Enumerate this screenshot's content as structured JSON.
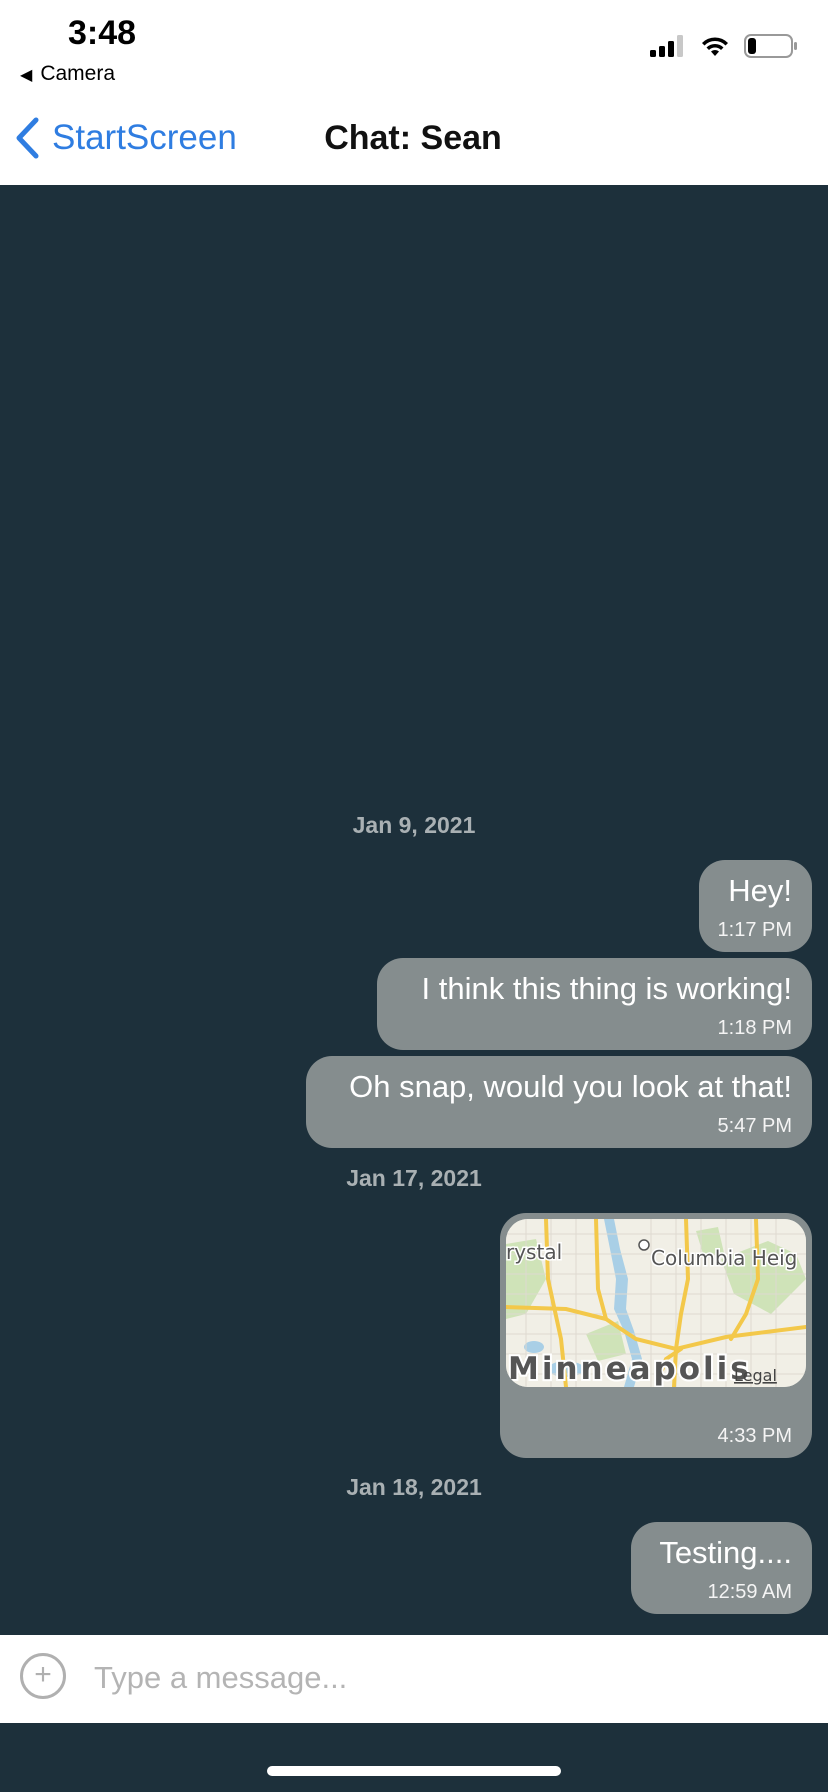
{
  "status_bar": {
    "time": "3:48",
    "back_app": "Camera",
    "icons": [
      "signal-icon",
      "wifi-icon",
      "battery-icon"
    ]
  },
  "nav": {
    "back_label": "StartScreen",
    "title": "Chat: Sean"
  },
  "colors": {
    "chat_background": "#1d303b",
    "bubble": "#858d8e",
    "accent": "#2f7de1",
    "date_label": "#a9b0b3"
  },
  "messages": {
    "date_1": "Jan 9, 2021",
    "m1": {
      "text": "Hey!",
      "time": "1:17 PM"
    },
    "m2": {
      "text": "I think this thing is working!",
      "time": "1:18 PM"
    },
    "m3": {
      "text": "Oh snap, would you look at that!",
      "time": "5:47 PM"
    },
    "date_2": "Jan 17, 2021",
    "m4": {
      "map": {
        "city": "Minneapolis",
        "label_left": "rystal",
        "label_right": "Columbia Heig",
        "legal": "Legal"
      },
      "time": "4:33 PM"
    },
    "date_3": "Jan 18, 2021",
    "m5": {
      "text": "Testing....",
      "time": "12:59 AM"
    }
  },
  "composer": {
    "placeholder": "Type a message..."
  }
}
